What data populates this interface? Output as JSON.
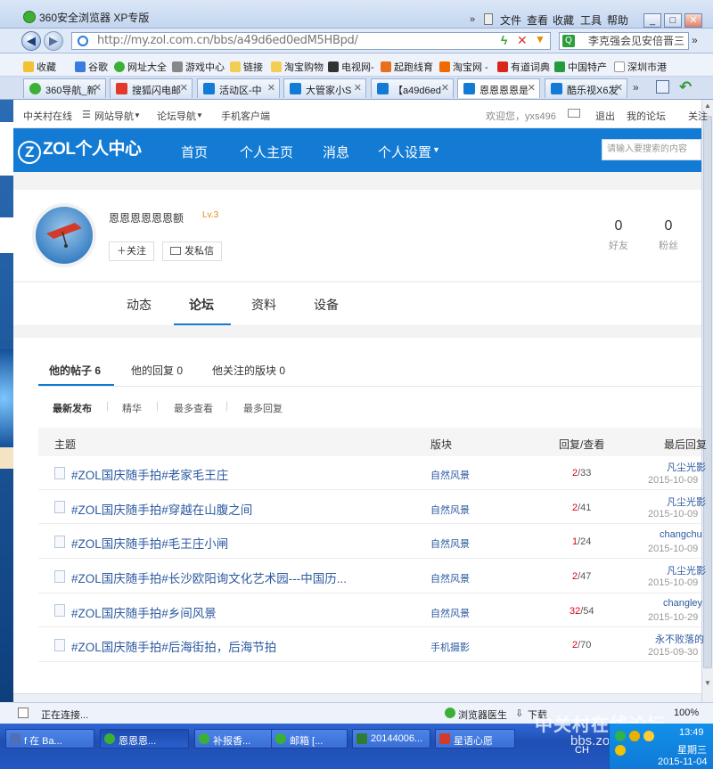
{
  "browser": {
    "title": "360安全浏览器 XP专版",
    "menu": [
      "文件",
      "查看",
      "收藏",
      "工具",
      "帮助"
    ],
    "url": "http://my.zol.com.cn/bbs/a49d6ed0edM5HBpd/",
    "search_value": "李克强会见安倍晋三",
    "favorites": [
      "收藏",
      "谷歌",
      "网址大全",
      "游戏中心",
      "链接",
      "淘宝购物",
      "电视网-",
      "起跑线育",
      "淘宝网 -",
      "有道词典",
      "中国特产",
      "深圳市港"
    ],
    "tabs": [
      "360导航_新",
      "搜狐闪电邮",
      "活动区-中",
      "大管家小S",
      "【a49d6ed",
      "恩恩恩恩是",
      "酷乐视X6发"
    ]
  },
  "topnav": {
    "items": [
      "中关村在线",
      "网站导航",
      "论坛导航",
      "手机客户端"
    ],
    "welcome": "欢迎您，yxs496",
    "logout": "退出",
    "my_forum": "我的论坛",
    "follow": "关注"
  },
  "header": {
    "logo": "ZOL个人中心",
    "nav": [
      "首页",
      "个人主页",
      "消息",
      "个人设置"
    ],
    "search_placeholder": "请输入要搜索的内容"
  },
  "profile": {
    "name": "恩恩恩恩恩恩额",
    "level": "Lv.3",
    "follow_btn": "关注",
    "message_btn": "发私信",
    "friends_count": "0",
    "friends_label": "好友",
    "fans_count": "0",
    "fans_label": "粉丝"
  },
  "profile_tabs": [
    "动态",
    "论坛",
    "资料",
    "设备"
  ],
  "sub_tabs": [
    "他的帖子 6",
    "他的回复 0",
    "他关注的版块 0"
  ],
  "filters": [
    "最新发布",
    "精华",
    "最多查看",
    "最多回复"
  ],
  "table": {
    "headers": [
      "主题",
      "版块",
      "回复/查看",
      "最后回复"
    ],
    "rows": [
      {
        "title": "#ZOL国庆随手拍#老家毛王庄",
        "board": "自然风景",
        "replies": "2",
        "views": "/33",
        "last_user": "凡尘光影",
        "last_date": "2015-10-09"
      },
      {
        "title": "#ZOL国庆随手拍#穿越在山腹之间",
        "board": "自然风景",
        "replies": "2",
        "views": "/41",
        "last_user": "凡尘光影",
        "last_date": "2015-10-09"
      },
      {
        "title": "#ZOL国庆随手拍#毛王庄小闸",
        "board": "自然风景",
        "replies": "1",
        "views": "/24",
        "last_user": "changchu",
        "last_date": "2015-10-09"
      },
      {
        "title": "#ZOL国庆随手拍#长沙欧阳询文化艺术园---中国历...",
        "board": "自然风景",
        "replies": "2",
        "views": "/47",
        "last_user": "凡尘光影",
        "last_date": "2015-10-09"
      },
      {
        "title": "#ZOL国庆随手拍#乡间风景",
        "board": "自然风景",
        "replies": "32",
        "views": "/54",
        "last_user": "changley",
        "last_date": "2015-10-29"
      },
      {
        "title": "#ZOL国庆随手拍#后海街拍，后海节拍",
        "board": "手机摄影",
        "replies": "2",
        "views": "/70",
        "last_user": "永不败落的",
        "last_date": "2015-09-30"
      }
    ]
  },
  "statusbar": {
    "text": "正在连接...",
    "doctor": "浏览器医生",
    "download": "下载",
    "zoom": "100%"
  },
  "taskbar": {
    "items": [
      "f 在 Ba...",
      "恩恩恩...",
      "补报香...",
      "邮箱 [...",
      "20144006...",
      "星语心愿"
    ],
    "watermark": "中关村在线论坛",
    "watermark_url": "bbs.zol.com.cn",
    "tray_ime": "CH",
    "clock": "13:49",
    "weekday": "星期三",
    "date": "2015-11-04"
  }
}
